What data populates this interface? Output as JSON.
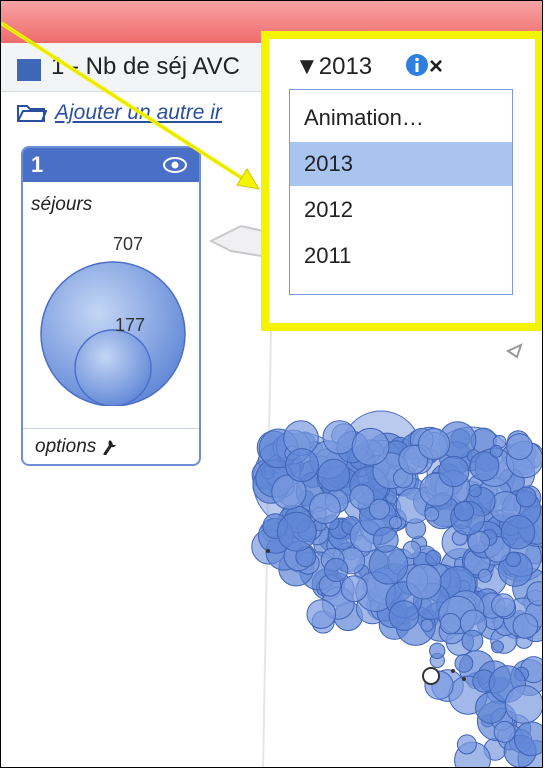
{
  "layer": {
    "title": "1 - Nb de séj AVC",
    "add_link": "Ajouter un autre ir"
  },
  "year_selector": {
    "selected": "▼2013",
    "options": [
      "Animation…",
      "2013",
      "2012",
      "2011"
    ],
    "active_index": 1
  },
  "legend": {
    "number": "1",
    "label": "séjours",
    "value_large": "707",
    "value_small": "177",
    "options_label": "options"
  },
  "colors": {
    "highlight_box": "#f4f400",
    "topbar": "#f06b6b",
    "bubble": "#4a74d0",
    "legend_header": "#4a6fc7",
    "active_option": "#a9c4ef"
  }
}
